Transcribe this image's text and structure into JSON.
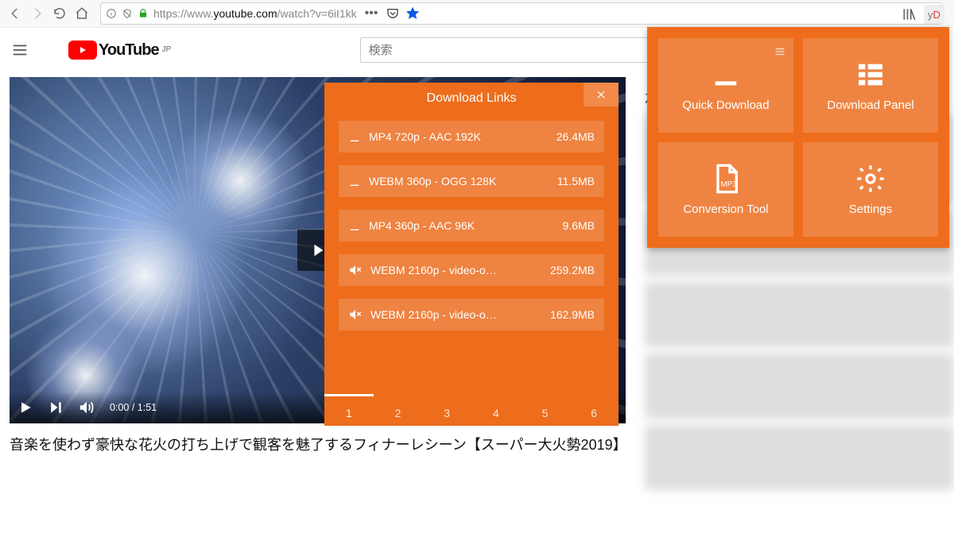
{
  "browser": {
    "url_proto": "https://www.",
    "url_domain": "youtube.com",
    "url_path": "/watch?v=6iI1kk"
  },
  "yt": {
    "brand": "YouTube",
    "region": "JP",
    "search_placeholder": "検索"
  },
  "video": {
    "cur_time": "0:00",
    "dur_time": "1:51",
    "title": "音楽を使わず豪快な花火の打ち上げで観客を魅了するフィナーレシーン【スーパー大火勢2019】"
  },
  "side": {
    "next": "次"
  },
  "dl": {
    "title": "Download Links",
    "items": [
      {
        "icon": "down",
        "label": "MP4 720p - AAC 192K",
        "size": "26.4MB"
      },
      {
        "icon": "down",
        "label": "WEBM 360p - OGG 128K",
        "size": "11.5MB"
      },
      {
        "icon": "down",
        "label": "MP4 360p - AAC 96K",
        "size": "9.6MB"
      },
      {
        "icon": "mute",
        "label": "WEBM 2160p - video-o…",
        "size": "259.2MB"
      },
      {
        "icon": "mute",
        "label": "WEBM 2160p - video-o…",
        "size": "162.9MB"
      }
    ],
    "tabs": [
      "1",
      "2",
      "3",
      "4",
      "5",
      "6"
    ],
    "active_tab": 0
  },
  "ext": {
    "tiles": [
      {
        "label": "Quick Download"
      },
      {
        "label": "Download Panel"
      },
      {
        "label": "Conversion Tool"
      },
      {
        "label": "Settings"
      }
    ]
  }
}
